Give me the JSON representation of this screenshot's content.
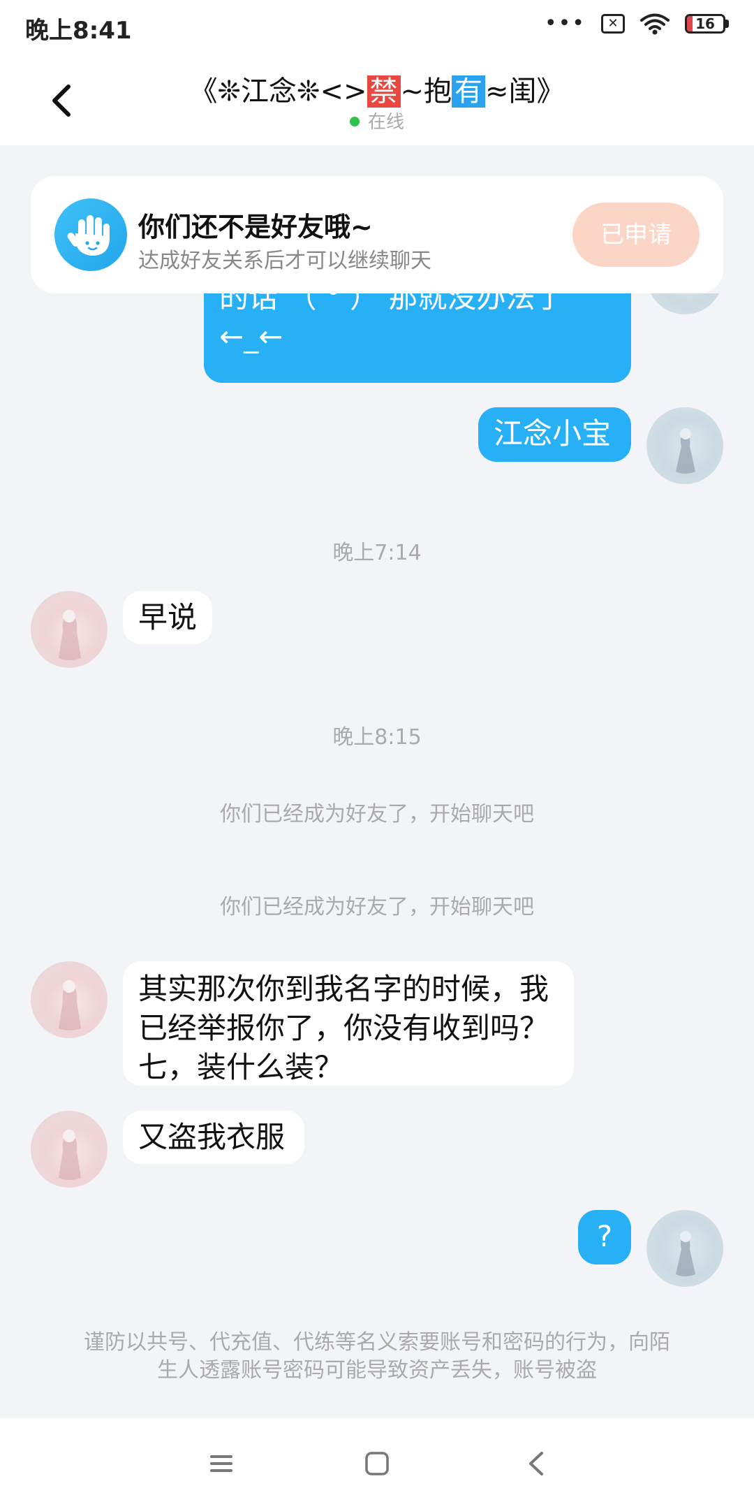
{
  "status_bar": {
    "time": "晚上8:41",
    "battery_level": "16",
    "battery_fraction": 0.16
  },
  "header": {
    "title_prefix": "《❊江念❊<>",
    "title_tag_red": "禁",
    "title_middle": "~抱",
    "title_tag_blue": "有",
    "title_suffix": "≈闺》",
    "presence": "在线"
  },
  "notice": {
    "title": "你们还不是好友哦~",
    "subtitle": "达成好友关系后才可以继续聊天",
    "button_label": "已申请"
  },
  "messages": {
    "partial_line_top": "的话 （ ° ） 那就没办法了",
    "partial_line_bottom": "←_←",
    "msg_out_1": "江念小宝",
    "time_1": "晚上7:14",
    "msg_in_1": "早说",
    "time_2": "晚上8:15",
    "system_1": "你们已经成为好友了，开始聊天吧",
    "system_2": "你们已经成为好友了，开始聊天吧",
    "msg_in_2_line1": "其实那次你到我名字的时候，我",
    "msg_in_2_line2": "已经举报你了，你没有收到吗？",
    "msg_in_2_line3": "七，装什么装？",
    "msg_in_3": "又盗我衣服",
    "msg_out_2": "?"
  },
  "footer_warning": {
    "line1": "谨防以共号、代充值、代练等名义索要账号和密码的行为，向陌",
    "line2": "生人透露账号密码可能导致资产丢失，账号被盗"
  },
  "icons": {
    "back": "chevron-left-icon",
    "notice": "waving-hand-icon",
    "nav_menu": "menu-icon",
    "nav_home": "home-square-icon",
    "nav_back": "back-triangle-icon"
  },
  "colors": {
    "accent": "#27b0f5",
    "apply_button": "#fbd6c6",
    "online_dot": "#2fc24a",
    "tag_red": "#e8483f",
    "tag_blue": "#2aa2f0"
  }
}
